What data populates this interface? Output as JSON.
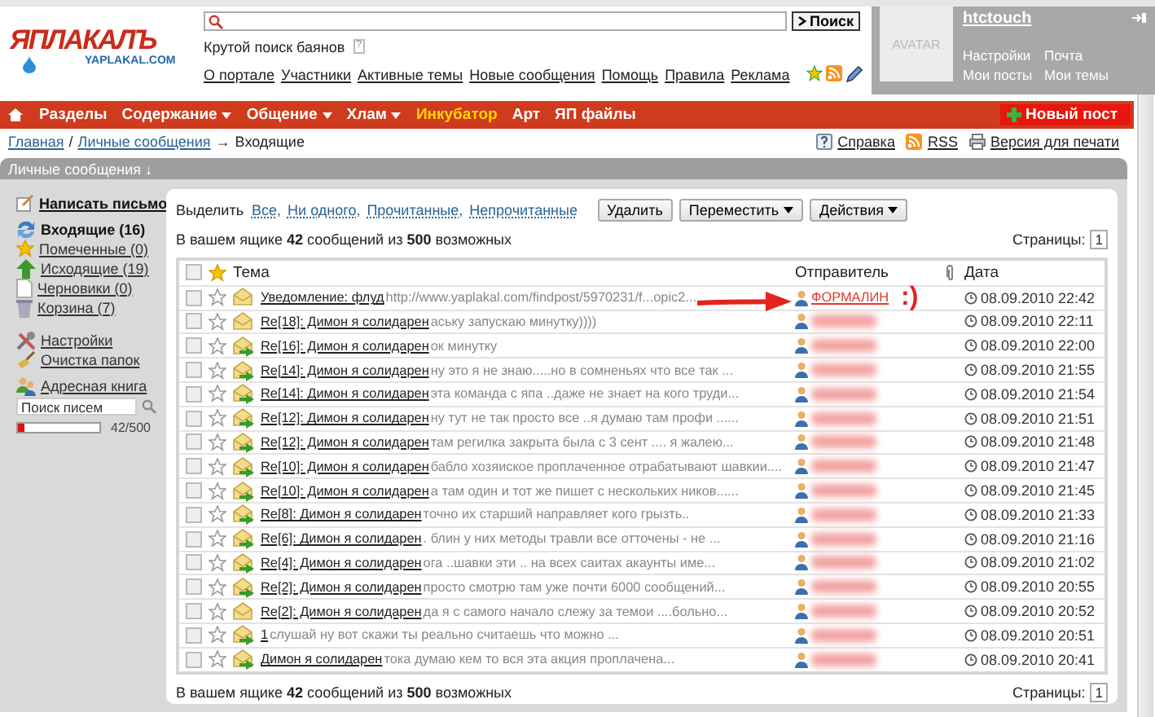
{
  "logo": {
    "title": "ЯПЛАКАЛЪ",
    "subtitle": "YAPLAKAL.COM"
  },
  "search": {
    "button": "Поиск",
    "hint": "Крутой поиск баянов",
    "hint_badge": "?"
  },
  "top_links": [
    "О портале",
    "Участники",
    "Активные темы",
    "Новые сообщения",
    "Помощь",
    "Правила",
    "Реклама"
  ],
  "user": {
    "avatar": "AVATAR",
    "name": "htctouch",
    "links": [
      "Настройки",
      "Почта",
      "Мои посты",
      "Мои темы"
    ]
  },
  "nav": {
    "items": [
      {
        "label": "Разделы",
        "dropdown": false,
        "highlight": false
      },
      {
        "label": "Содержание",
        "dropdown": true,
        "highlight": false
      },
      {
        "label": "Общение",
        "dropdown": true,
        "highlight": false
      },
      {
        "label": "Хлам",
        "dropdown": true,
        "highlight": false
      },
      {
        "label": "Инкубатор",
        "dropdown": false,
        "highlight": true
      },
      {
        "label": "Арт",
        "dropdown": false,
        "highlight": false
      },
      {
        "label": "ЯП файлы",
        "dropdown": false,
        "highlight": false
      }
    ],
    "new_post": "Новый пост"
  },
  "breadcrumb": {
    "links": [
      "Главная",
      "Личные сообщения"
    ],
    "separator": "/",
    "arrow": "→",
    "current": "Входящие"
  },
  "tools": [
    {
      "kind": "help",
      "label": "Справка"
    },
    {
      "kind": "rss",
      "label": "RSS"
    },
    {
      "kind": "print",
      "label": "Версия для печати"
    }
  ],
  "section_title": "Личные сообщения ↓",
  "sidebar": {
    "compose": "Написать письмо",
    "folders": [
      {
        "kind": "inbox",
        "label": "Входящие (16)",
        "selected": true
      },
      {
        "kind": "starred",
        "label": "Помеченные (0)",
        "selected": false
      },
      {
        "kind": "sent",
        "label": "Исходящие (19)",
        "selected": false
      },
      {
        "kind": "drafts",
        "label": "Черновики (0)",
        "selected": false
      },
      {
        "kind": "trash",
        "label": "Корзина (7)",
        "selected": false
      }
    ],
    "tools": [
      {
        "kind": "settings",
        "label": "Настройки"
      },
      {
        "kind": "clean",
        "label": "Очистка папок"
      }
    ],
    "address_book": "Адресная книга",
    "search_placeholder": "Поиск писем",
    "quota": {
      "level": 0.084,
      "reading": "42/500"
    }
  },
  "toolbar": {
    "select_label": "Выделить",
    "select_links": [
      "Все,",
      "Ни одного,",
      "Прочитанные,",
      "Непрочитанные"
    ],
    "buttons": [
      {
        "label": "Удалить",
        "dropdown": false
      },
      {
        "label": "Переместить",
        "dropdown": true
      },
      {
        "label": "Действия",
        "dropdown": true
      }
    ]
  },
  "summary_top": "В вашем ящике **42** сообщений из **500** возможных",
  "summary_bottom": "В вашем ящике **42** сообщений из **500** возможных",
  "pages_top": {
    "label": "Страницы:",
    "page": "1"
  },
  "pages_bottom": {
    "label": "Страницы:",
    "page": "1"
  },
  "columns": {
    "select_all_checked": false,
    "subject": "Тема",
    "sender": "Отправитель",
    "date": "Дата"
  },
  "messages": [
    {
      "subject": "Уведомление: флуд",
      "preview": "http://www.yaplakal.com/findpost/5970231/f...opic2...",
      "sender": "ФОРМАЛИН",
      "sender_hidden": false,
      "date": "08.09.2010 22:42",
      "replied": false,
      "starred": false,
      "checked": false
    },
    {
      "subject": "Re[18]: Димон я солидарен",
      "preview": "аську запускаю минутку))))",
      "sender_hidden": true,
      "date": "08.09.2010 22:11",
      "replied": false,
      "starred": false,
      "checked": false
    },
    {
      "subject": "Re[16]: Димон я солидарен",
      "preview": "ок минутку",
      "sender_hidden": true,
      "date": "08.09.2010 22:00",
      "replied": true,
      "starred": false,
      "checked": false
    },
    {
      "subject": "Re[14]: Димон я солидарен",
      "preview": "ну это я не знаю.....но в сомненьях что все так ...",
      "sender_hidden": true,
      "date": "08.09.2010 21:55",
      "replied": true,
      "starred": false,
      "checked": false
    },
    {
      "subject": "Re[14]: Димон я солидарен",
      "preview": "эта команда с япа ..даже не знает на кого труди...",
      "sender_hidden": true,
      "date": "08.09.2010 21:54",
      "replied": true,
      "starred": false,
      "checked": false
    },
    {
      "subject": "Re[12]: Димон я солидарен",
      "preview": "ну тут не так просто все ..я думаю там профи ......",
      "sender_hidden": true,
      "date": "08.09.2010 21:51",
      "replied": true,
      "starred": false,
      "checked": false
    },
    {
      "subject": "Re[12]: Димон я солидарен",
      "preview": "там регилка закрыта была с 3 сент .... я жалею...",
      "sender_hidden": true,
      "date": "08.09.2010 21:48",
      "replied": true,
      "starred": false,
      "checked": false
    },
    {
      "subject": "Re[10]: Димон я солидарен",
      "preview": "бабло хозяиское проплаченное отрабатывают шавкии....",
      "sender_hidden": true,
      "date": "08.09.2010 21:47",
      "replied": true,
      "starred": false,
      "checked": false
    },
    {
      "subject": "Re[10]: Димон я солидарен",
      "preview": "а там один и тот же пишет с нескольких ников......",
      "sender_hidden": true,
      "date": "08.09.2010 21:45",
      "replied": true,
      "starred": false,
      "checked": false
    },
    {
      "subject": "Re[8]: Димон я солидарен",
      "preview": "точно их старший направляет кого грызть..",
      "sender_hidden": true,
      "date": "08.09.2010 21:33",
      "replied": true,
      "starred": false,
      "checked": false
    },
    {
      "subject": "Re[6]: Димон я солидарен",
      "preview": ". блин у них методы травли все отточены - не ...",
      "sender_hidden": true,
      "date": "08.09.2010 21:16",
      "replied": true,
      "starred": false,
      "checked": false
    },
    {
      "subject": "Re[4]: Димон я солидарен",
      "preview": "ога ..шавки эти .. на всех саитах акаунты име...",
      "sender_hidden": true,
      "date": "08.09.2010 21:02",
      "replied": true,
      "starred": false,
      "checked": false
    },
    {
      "subject": "Re[2]: Димон я солидарен",
      "preview": "просто смотрю там уже почти 6000 сообщений...",
      "sender_hidden": true,
      "date": "08.09.2010 20:55",
      "replied": true,
      "starred": false,
      "checked": false
    },
    {
      "subject": "Re[2]: Димон я солидарен",
      "preview": "да я с самого начало слежу за темои ....больно...",
      "sender_hidden": true,
      "date": "08.09.2010 20:52",
      "replied": false,
      "starred": false,
      "checked": false
    },
    {
      "subject": "1",
      "preview": "слушай ну вот скажи ты реально считаешь что можно ...",
      "sender_hidden": true,
      "date": "08.09.2010 20:51",
      "replied": true,
      "starred": false,
      "checked": false
    },
    {
      "subject": "Димон я солидарен",
      "preview": "тока думаю кем то вся эта акция проплачена...",
      "sender_hidden": true,
      "date": "08.09.2010 20:41",
      "replied": true,
      "starred": false,
      "checked": false
    }
  ],
  "annotation": {
    "text": ":)"
  }
}
